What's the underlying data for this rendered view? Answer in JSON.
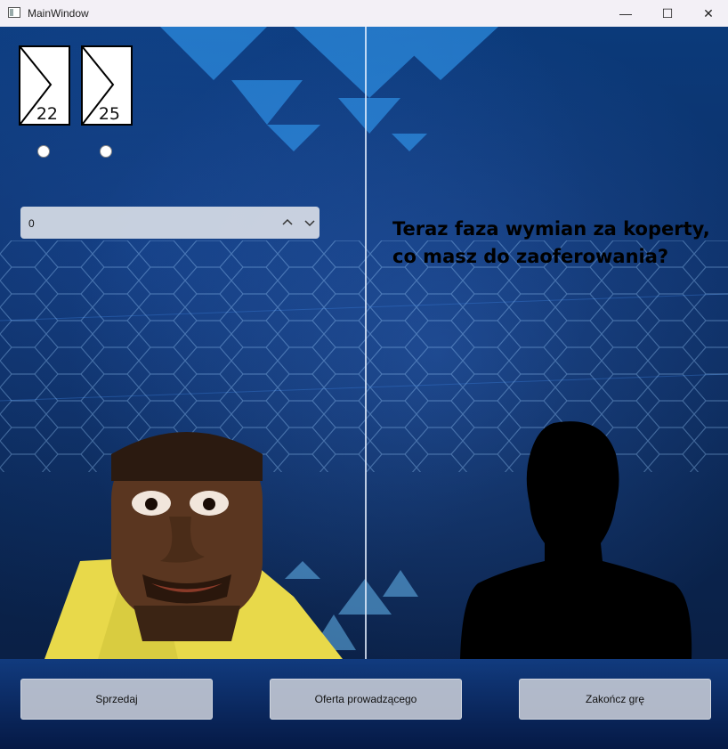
{
  "window": {
    "title": "MainWindow",
    "controls": {
      "minimize": "—",
      "maximize": "☐",
      "close": "✕"
    }
  },
  "cards": [
    {
      "value": "22"
    },
    {
      "value": "25"
    }
  ],
  "spinbox": {
    "value": "0",
    "up_icon": "chevron-up-icon",
    "down_icon": "chevron-down-icon"
  },
  "message": "Teraz faza wymian za koperty, co masz do zaoferowania?",
  "buttons": {
    "sell": "Sprzedaj",
    "host_offer": "Oferta prowadzącego",
    "end_game": "Zakończ grę"
  },
  "colors": {
    "background": "#0b3a7a",
    "accent": "#1e90ff"
  }
}
